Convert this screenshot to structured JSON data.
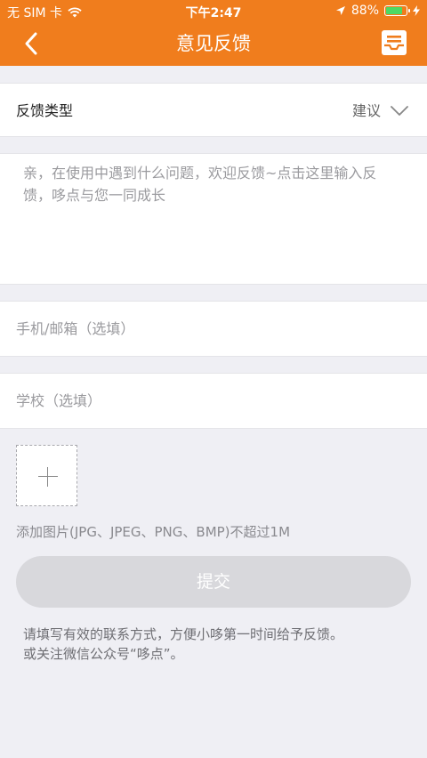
{
  "status_bar": {
    "carrier": "无 SIM 卡",
    "time": "下午2:47",
    "battery_percent": "88%",
    "battery_level": 0.88
  },
  "nav": {
    "title": "意见反馈",
    "back_icon": "chevron-left-icon",
    "right_icon": "message-inbox-icon"
  },
  "feedback_type": {
    "label": "反馈类型",
    "value": "建议"
  },
  "content": {
    "placeholder": "亲，在使用中遇到什么问题，欢迎反馈~点击这里输入反馈，哆点与您一同成长"
  },
  "contact": {
    "placeholder": "手机/邮箱（选填）"
  },
  "school": {
    "placeholder": "学校（选填）"
  },
  "images": {
    "hint": "添加图片(JPG、JPEG、PNG、BMP)不超过1M"
  },
  "submit": {
    "label": "提交"
  },
  "footer": {
    "line1": "请填写有效的联系方式，方便小哆第一时间给予反馈。",
    "line2": "或关注微信公众号“哆点”。"
  },
  "colors": {
    "brand": "#f07d1d",
    "background": "#efeff4",
    "button_disabled": "#d8d8dc"
  }
}
